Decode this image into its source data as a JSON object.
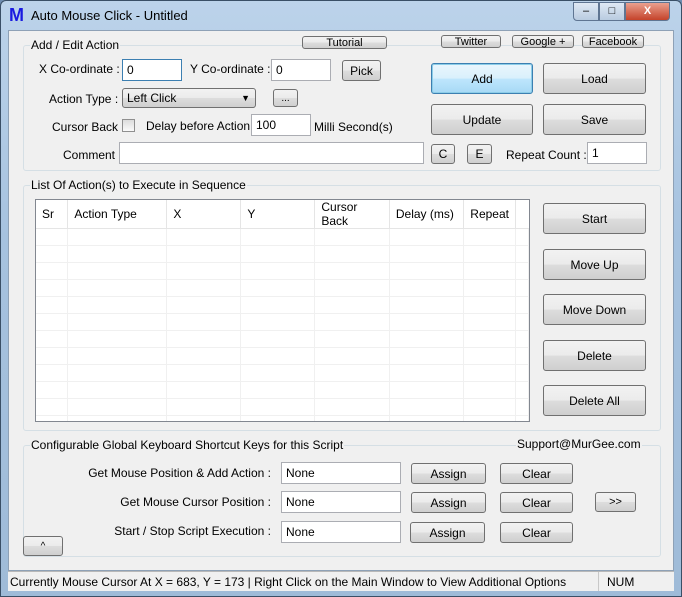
{
  "window": {
    "title": "Auto Mouse Click - Untitled",
    "logo": "M",
    "minimize": "–",
    "maximize": "□",
    "close": "X"
  },
  "top_links": {
    "tutorial": "Tutorial",
    "twitter": "Twitter",
    "google": "Google +",
    "facebook": "Facebook"
  },
  "edit": {
    "group_label": "Add / Edit Action",
    "x_label": "X Co-ordinate :",
    "x_value": "0",
    "y_label": "Y Co-ordinate :",
    "y_value": "0",
    "pick": "Pick",
    "action_type_label": "Action Type :",
    "action_type_value": "Left Click",
    "more": "...",
    "cursor_back_label": "Cursor Back :",
    "cursor_back_checked": false,
    "delay_label": "Delay before Action :",
    "delay_value": "100",
    "delay_unit": "Milli Second(s)",
    "comment_label": "Comment :",
    "comment_value": "",
    "c": "C",
    "e": "E",
    "repeat_label": "Repeat Count :",
    "repeat_value": "1",
    "add": "Add",
    "load": "Load",
    "update": "Update",
    "save": "Save"
  },
  "list": {
    "group_label": "List Of Action(s) to Execute in Sequence",
    "columns": [
      "Sr",
      "Action Type",
      "X",
      "Y",
      "Cursor Back",
      "Delay (ms)",
      "Repeat"
    ],
    "rows": [],
    "start": "Start",
    "move_up": "Move Up",
    "move_down": "Move Down",
    "delete": "Delete",
    "delete_all": "Delete All"
  },
  "shortcuts": {
    "group_label": "Configurable Global Keyboard Shortcut Keys for this Script",
    "support": "Support@MurGee.com",
    "rows": [
      {
        "label": "Get Mouse Position & Add Action :",
        "value": "None"
      },
      {
        "label": "Get Mouse Cursor Position :",
        "value": "None"
      },
      {
        "label": "Start / Stop Script Execution :",
        "value": "None"
      }
    ],
    "assign": "Assign",
    "clear": "Clear",
    "expand": ">>",
    "collapse": "^"
  },
  "status": {
    "text": "Currently Mouse Cursor At X = 683, Y = 173 | Right Click on the Main Window to View Additional Options",
    "num": "NUM"
  }
}
